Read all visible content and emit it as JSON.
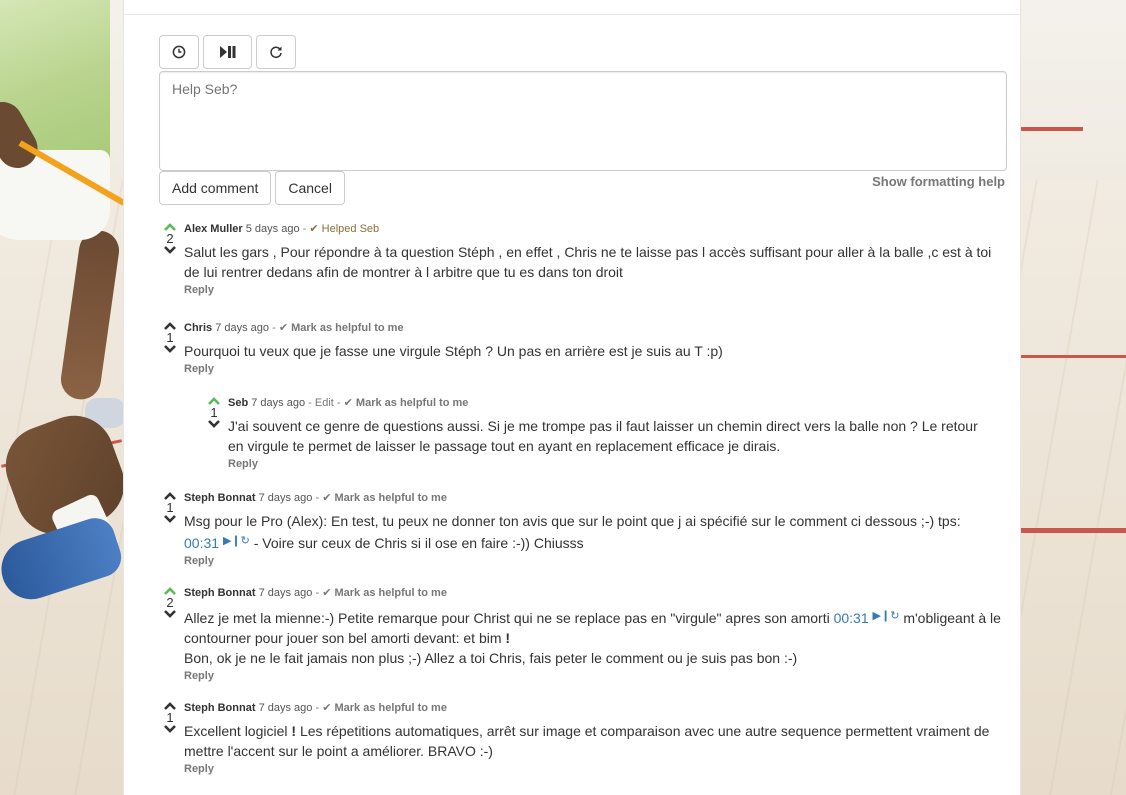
{
  "toolbar": {
    "buttons": [
      {
        "name": "clock-icon"
      },
      {
        "name": "play-pause-icon"
      },
      {
        "name": "refresh-icon"
      }
    ]
  },
  "compose": {
    "placeholder": "Help Seb?",
    "add_label": "Add comment",
    "cancel_label": "Cancel",
    "formatting_help": "Show formatting help"
  },
  "comments": [
    {
      "author": "Alex Muller",
      "time": "5 days ago",
      "badge": "Helped Seb",
      "votes": "2",
      "text": "Salut les gars , Pour répondre à ta question Stéph , en effet , Chris ne te laisse pas l accès suffisant pour aller à la balle ,c est à toi de lui rentrer dedans afin de montrer à l arbitre que tu es dans ton droit",
      "reply": "Reply"
    },
    {
      "author": "Chris",
      "time": "7 days ago",
      "helpful": "Mark as helpful to me",
      "votes": "1",
      "text": "Pourquoi tu veux que je fasse une virgule Stéph ? Un pas en arrière est je suis au T :p)",
      "reply": "Reply"
    },
    {
      "author": "Seb",
      "time": "7 days ago",
      "edit": "Edit",
      "helpful": "Mark as helpful to me",
      "votes": "1",
      "text": "J'ai souvent ce genre de questions aussi. Si je me trompe pas il faut laisser un chemin direct vers la balle non ? Le retour en virgule te permet de laisser le passage tout en ayant en replacement efficace je dirais.",
      "reply": "Reply"
    },
    {
      "author": "Steph Bonnat",
      "time": "7 days ago",
      "helpful": "Mark as helpful to me",
      "votes": "1",
      "text_a": "Msg pour le Pro (Alex): En test, tu peux ne donner ton avis que sur le point que j ai spécifié sur le comment ci dessous ;-) tps:",
      "timestamp": "00:31",
      "text_b": " - Voire sur ceux de Chris si il ose en faire :-)) Chiusss",
      "reply": "Reply"
    },
    {
      "author": "Steph Bonnat",
      "time": "7 days ago",
      "helpful": "Mark as helpful to me",
      "votes": "2",
      "text_a": "Allez je met la mienne:-) Petite remarque pour Christ qui ne se replace pas en \"virgule\" apres son amorti",
      "timestamp": "00:31",
      "text_b": " m'obligeant à le contourner pour jouer son bel amorti devant: et bim ",
      "text_bold": "!",
      "text_c": "Bon, ok je ne le fait jamais non plus ;-) Allez a toi Chris, fais peter le comment ou je suis pas bon :-)",
      "reply": "Reply"
    },
    {
      "author": "Steph Bonnat",
      "time": "7 days ago",
      "helpful": "Mark as helpful to me",
      "votes": "1",
      "text_a": "Excellent logiciel ",
      "text_bold": "!",
      "text_b": " Les répetitions automatiques, arrêt sur image et comparaison avec une autre sequence permettent vraiment de mettre l'accent sur le point a améliorer. BRAVO :-)",
      "reply": "Reply"
    }
  ],
  "colors": {
    "upvote_active": "#5cb85c",
    "link": "#337ab7",
    "helped": "#8a6d3b",
    "court_line": "#c9574a"
  }
}
